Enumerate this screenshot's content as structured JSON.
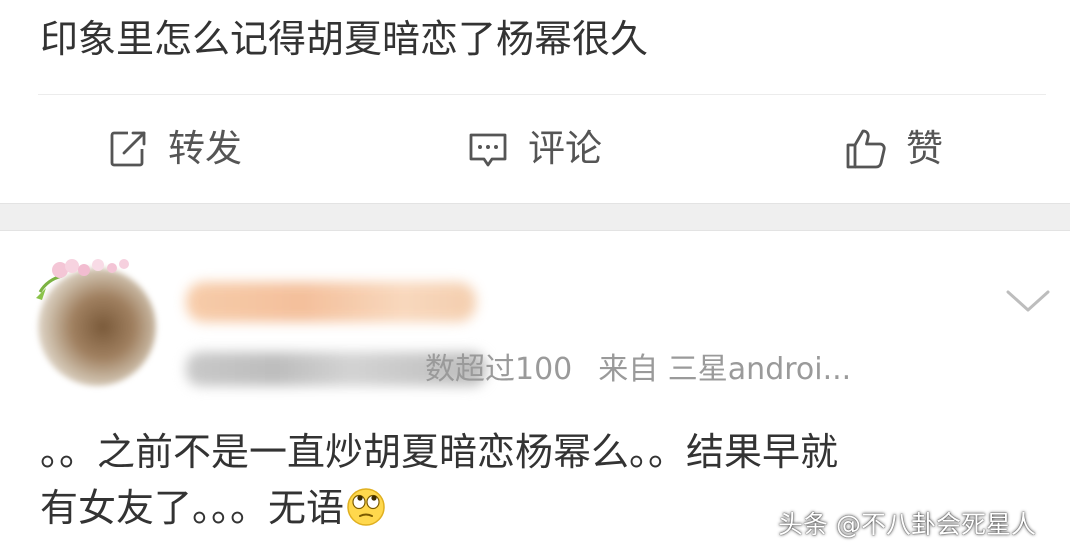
{
  "post": {
    "text": "印象里怎么记得胡夏暗恋了杨幂很久"
  },
  "actions": {
    "repost": {
      "label": "转发",
      "icon": "repost-icon"
    },
    "comment": {
      "label": "评论",
      "icon": "comment-icon"
    },
    "like": {
      "label": "赞",
      "icon": "thumbs-up-icon"
    }
  },
  "comment": {
    "meta_visible": "数超过100",
    "source": "来自 三星androi...",
    "lines": [
      "。。之前不是一直炒胡夏暗恋杨幂么。。结果早就",
      "有女友了。。。无语"
    ],
    "emoji": "eye-roll-emoji"
  },
  "watermark": {
    "text": "头条 @不八卦会死星人"
  },
  "colors": {
    "text": "#333333",
    "secondary": "#9a9a9a",
    "band": "#efefef"
  }
}
